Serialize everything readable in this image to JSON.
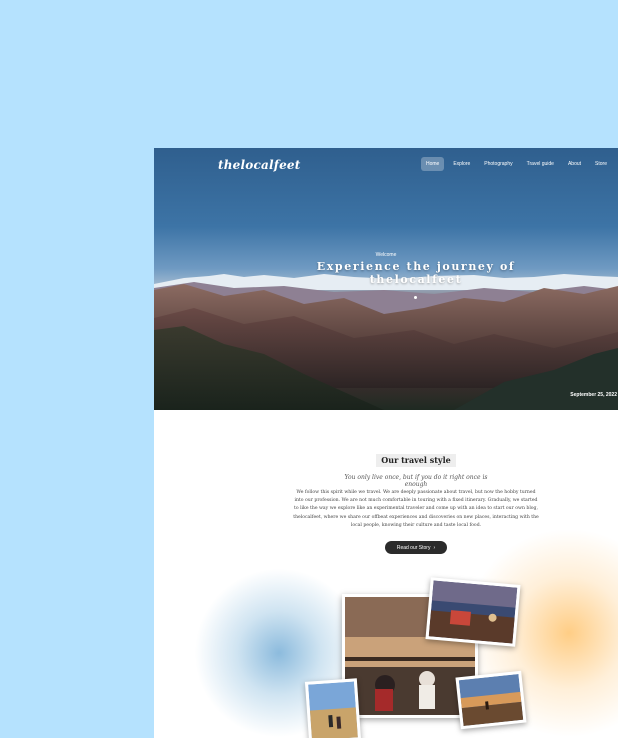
{
  "site": {
    "brand": "thelocalfeet"
  },
  "nav": [
    {
      "label": "Home",
      "active": true
    },
    {
      "label": "Explore"
    },
    {
      "label": "Photography"
    },
    {
      "label": "Travel guide"
    },
    {
      "label": "About"
    },
    {
      "label": "Store"
    }
  ],
  "hero": {
    "welcome": "Welcome",
    "title_line1": "Experience the journey of",
    "title_line2": "thelocalfeet",
    "date": "September 25, 2022"
  },
  "travel_style": {
    "title": "Our travel style",
    "tagline": "You only live once, but if you do it right once is enough",
    "paragraph": "We follow this spirit while we travel. We are deeply passionate about travel, but now the hobby turned into our profession. We are not much comfortable in touring with a fixed itinerary. Gradually, we started to like the way we explore like an experimental traveler and come up with an idea to start our own blog, thelocalfeet, where we share our offbeat experiences and discoveries on new places, interacting with the local people, knowing their culture and taste local food.",
    "cta_label": "Read our Story",
    "cta_icon": "arrow-right-icon"
  },
  "colors": {
    "backdrop": "#b5e2fe",
    "cta_bg": "#2b2b2b",
    "glow_blue": "#78afd7",
    "glow_orange": "#ffc878"
  }
}
